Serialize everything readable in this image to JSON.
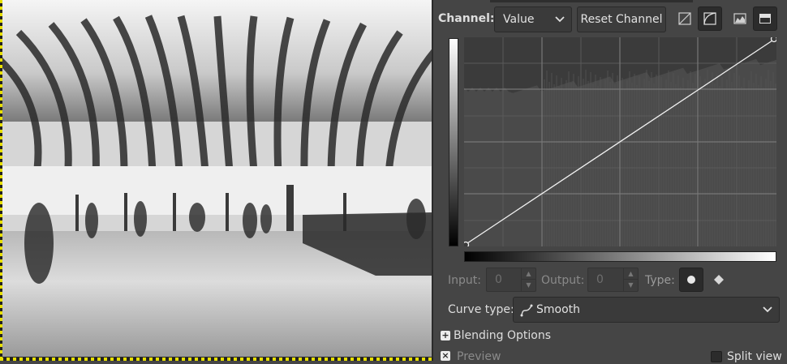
{
  "canvas": {
    "image_alt": "Black and white photo of Oculus hall interior"
  },
  "curves": {
    "channel_label": "Channel:",
    "channel_value": "Value",
    "reset_label": "Reset Channel",
    "input_label": "Input:",
    "input_value": "0",
    "output_label": "Output:",
    "output_value": "0",
    "type_label": "Type:",
    "curve_type_label": "Curve type:",
    "curve_type_value": "Smooth"
  },
  "options": {
    "blending_label": "Blending Options",
    "preview_label": "Preview",
    "split_label": "Split view"
  },
  "colors": {
    "panel_bg": "#454545",
    "graph_bg": "#3b3b3b",
    "curve": "#ffffff",
    "selection": "#e8e000"
  }
}
